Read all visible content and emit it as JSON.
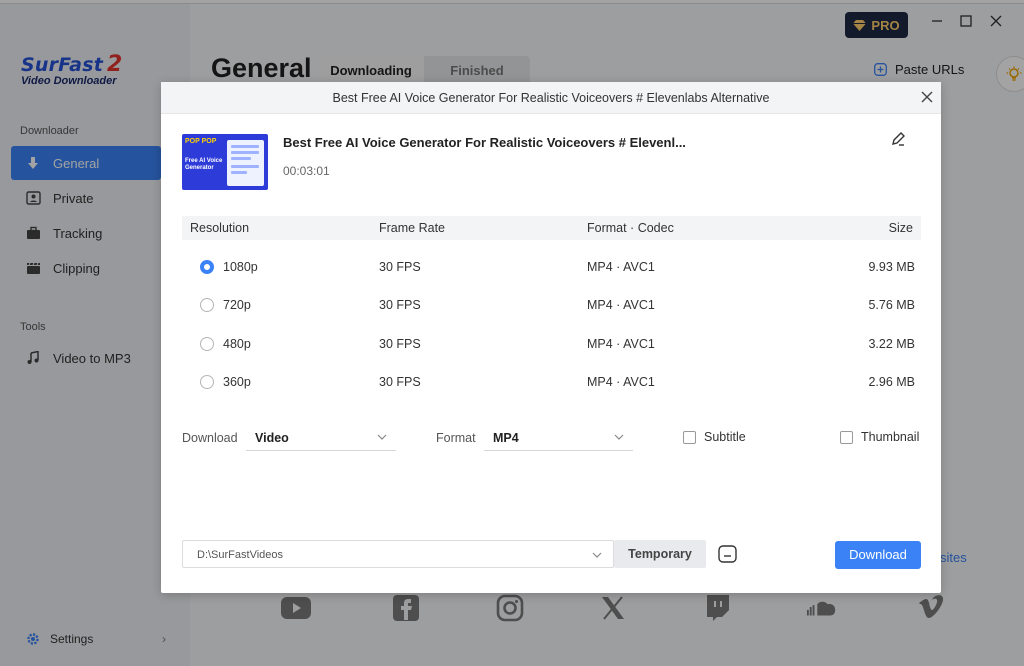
{
  "app": {
    "logo_line1": "SurFast",
    "logo_line2_num": "2",
    "logo_sub": "Video Downloader",
    "pro_label": "PRO"
  },
  "sidebar": {
    "section_downloader": "Downloader",
    "items": [
      {
        "label": "General",
        "icon": "download-arrow-icon",
        "active": true
      },
      {
        "label": "Private",
        "icon": "private-icon"
      },
      {
        "label": "Tracking",
        "icon": "briefcase-icon"
      },
      {
        "label": "Clipping",
        "icon": "clapper-icon"
      }
    ],
    "section_tools": "Tools",
    "tools": [
      {
        "label": "Video to MP3",
        "icon": "music-note-icon"
      }
    ],
    "settings_label": "Settings"
  },
  "main": {
    "page_title": "General",
    "tabs": [
      {
        "label": "Downloading"
      },
      {
        "label": "Finished"
      }
    ],
    "paste_urls": "Paste URLs",
    "sites_partial": "sites"
  },
  "modal": {
    "title": "Best Free AI Voice Generator For Realistic Voiceovers # Elevenlabs Alternative",
    "video_title": "Best Free AI Voice Generator For Realistic Voiceovers # Elevenl...",
    "duration": "00:03:01",
    "thumb_top": "POP POP",
    "thumb_text": "Free AI Voice Generator",
    "table": {
      "headers": [
        "Resolution",
        "Frame Rate",
        "Format · Codec",
        "Size"
      ],
      "rows": [
        {
          "res": "1080p",
          "fps": "30 FPS",
          "fmt": "MP4 · AVC1",
          "size": "9.93 MB",
          "selected": true
        },
        {
          "res": "720p",
          "fps": "30 FPS",
          "fmt": "MP4 · AVC1",
          "size": "5.76 MB"
        },
        {
          "res": "480p",
          "fps": "30 FPS",
          "fmt": "MP4 · AVC1",
          "size": "3.22 MB"
        },
        {
          "res": "360p",
          "fps": "30 FPS",
          "fmt": "MP4 · AVC1",
          "size": "2.96 MB"
        }
      ]
    },
    "download_label": "Download",
    "download_value": "Video",
    "format_label": "Format",
    "format_value": "MP4",
    "subtitle_label": "Subtitle",
    "thumbnail_label": "Thumbnail",
    "path_value": "D:\\SurFastVideos",
    "temporary_label": "Temporary",
    "download_button": "Download"
  },
  "colors": {
    "accent": "#3b82f6",
    "pro_bg": "#1d2a44",
    "pro_fg": "#ffcf6b"
  }
}
